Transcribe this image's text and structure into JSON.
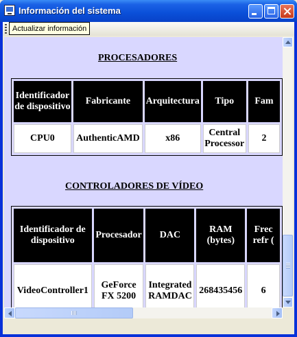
{
  "window": {
    "title": "Información del sistema",
    "icon": "system-info-icon"
  },
  "toolbar": {
    "refresh_label": "Actualizar información"
  },
  "processors": {
    "heading": "PROCESADORES",
    "headers": [
      "Identificador de dispositivo",
      "Fabricante",
      "Arquitectura",
      "Tipo",
      "Fam"
    ],
    "rows": [
      [
        "CPU0",
        "AuthenticAMD",
        "x86",
        "Central Processor",
        "2"
      ]
    ]
  },
  "video": {
    "heading": "CONTROLADORES DE VÍDEO",
    "headers": [
      "Identificador de dispositivo",
      "Procesador",
      "DAC",
      "RAM (bytes)",
      "Frec refr ("
    ],
    "rows": [
      [
        "VideoController1",
        "GeForce FX 5200",
        "Integrated RAMDAC",
        "268435456",
        "6"
      ]
    ]
  }
}
